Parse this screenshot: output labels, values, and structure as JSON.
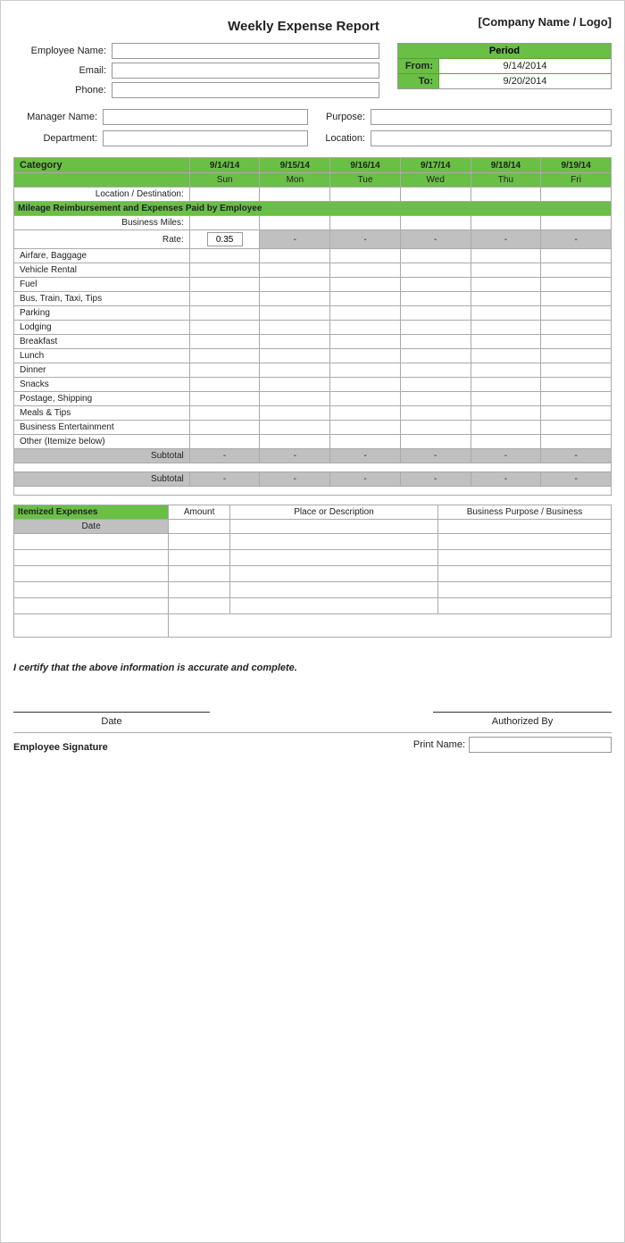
{
  "header": {
    "title": "Weekly Expense Report",
    "company": "[Company Name / Logo]"
  },
  "form": {
    "employee_name_label": "Employee Name:",
    "email_label": "Email:",
    "phone_label": "Phone:",
    "manager_label": "Manager Name:",
    "department_label": "Department:",
    "purpose_label": "Purpose:",
    "location_label": "Location:"
  },
  "period": {
    "title": "Period",
    "from_label": "From:",
    "from_value": "9/14/2014",
    "to_label": "To:",
    "to_value": "9/20/2014"
  },
  "table": {
    "category_label": "Category",
    "dates": [
      "9/14/14",
      "9/15/14",
      "9/16/14",
      "9/17/14",
      "9/18/14",
      "9/19/14"
    ],
    "days": [
      "Sun",
      "Mon",
      "Tue",
      "Wed",
      "Thu",
      "Fri"
    ],
    "location_row": "Location / Destination:",
    "mileage_section": "Mileage Reimbursement and Expenses Paid by Employee",
    "business_miles_label": "Business Miles:",
    "rate_label": "Rate:",
    "rate_value": "0.35",
    "dash": "-",
    "categories": [
      "Airfare, Baggage",
      "Vehicle Rental",
      "Fuel",
      "Bus, Train, Taxi, Tips",
      "Parking",
      "Lodging",
      "Breakfast",
      "Lunch",
      "Dinner",
      "Snacks",
      "Postage, Shipping",
      "Meals & Tips",
      "Business Entertainment",
      "Other (Itemize below)"
    ],
    "subtotal_label": "Subtotal"
  },
  "itemized": {
    "header_label": "Itemized Expenses",
    "amount_label": "Amount",
    "place_label": "Place or Description",
    "business_label": "Business Purpose / Business",
    "date_label": "Date"
  },
  "certification": {
    "text": "I certify that the above information is accurate and complete."
  },
  "signature": {
    "date_label": "Date",
    "authorized_label": "Authorized By",
    "employee_sig_label": "Employee Signature",
    "print_name_label": "Print Name:"
  }
}
